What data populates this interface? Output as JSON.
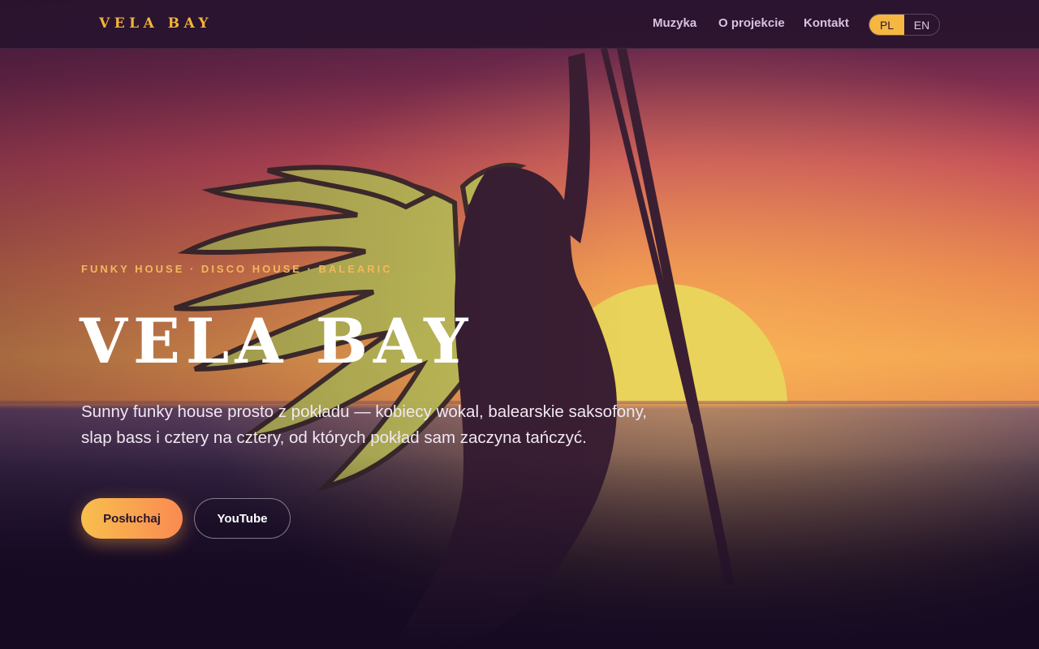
{
  "brand": {
    "logo_text": "VELA BAY"
  },
  "nav": {
    "links": [
      {
        "label": "Muzyka"
      },
      {
        "label": "O projekcie"
      },
      {
        "label": "Kontakt"
      }
    ],
    "languages": [
      {
        "label": "PL",
        "active": true
      },
      {
        "label": "EN",
        "active": false
      }
    ]
  },
  "hero": {
    "eyebrow": "FUNKY HOUSE · DISCO HOUSE · BALEARIC",
    "title": "VELA BAY",
    "description": "Sunny funky house prosto z pokładu — kobiecy wokal, balearskie saksofony, slap bass i cztery na cztery, od których pokład sam zaczyna tańczyć.",
    "primary_button": "Posłuchaj",
    "secondary_button": "YouTube",
    "image_description": "sunset-silhouette-illustration"
  },
  "colors": {
    "accent": "#f5b642",
    "accent_gradient_end": "#fa8a52",
    "background": "#150a22",
    "nav_background": "#28142e"
  }
}
